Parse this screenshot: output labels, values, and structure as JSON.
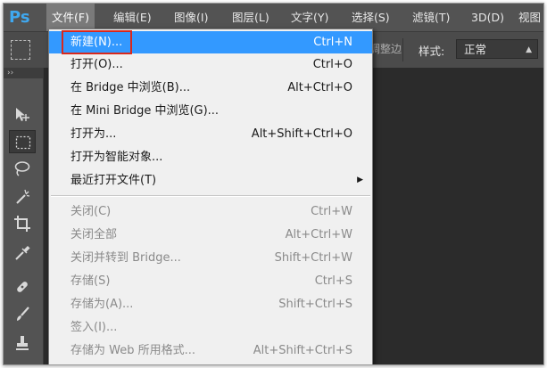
{
  "app": {
    "logo": "Ps"
  },
  "menubar": {
    "items": [
      {
        "label": "文件(F)",
        "active": true
      },
      {
        "label": "编辑(E)"
      },
      {
        "label": "图像(I)"
      },
      {
        "label": "图层(L)"
      },
      {
        "label": "文字(Y)"
      },
      {
        "label": "选择(S)"
      },
      {
        "label": "滤镜(T)"
      },
      {
        "label": "3D(D)"
      },
      {
        "label": "视图"
      }
    ]
  },
  "options": {
    "partial_text": "调整边",
    "style_label": "样式:",
    "style_value": "正常"
  },
  "file_menu": {
    "items": [
      {
        "label": "新建(N)...",
        "shortcut": "Ctrl+N",
        "state": "highlight"
      },
      {
        "label": "打开(O)...",
        "shortcut": "Ctrl+O"
      },
      {
        "label": "在 Bridge 中浏览(B)...",
        "shortcut": "Alt+Ctrl+O"
      },
      {
        "label": "在 Mini Bridge 中浏览(G)...",
        "shortcut": ""
      },
      {
        "label": "打开为...",
        "shortcut": "Alt+Shift+Ctrl+O"
      },
      {
        "label": "打开为智能对象...",
        "shortcut": ""
      },
      {
        "label": "最近打开文件(T)",
        "shortcut": "",
        "submenu": true
      },
      {
        "label": "关闭(C)",
        "shortcut": "Ctrl+W",
        "state": "disabled"
      },
      {
        "label": "关闭全部",
        "shortcut": "Alt+Ctrl+W",
        "state": "disabled"
      },
      {
        "label": "关闭并转到 Bridge...",
        "shortcut": "Shift+Ctrl+W",
        "state": "disabled"
      },
      {
        "label": "存储(S)",
        "shortcut": "Ctrl+S",
        "state": "disabled"
      },
      {
        "label": "存储为(A)...",
        "shortcut": "Shift+Ctrl+S",
        "state": "disabled"
      },
      {
        "label": "签入(I)...",
        "shortcut": "",
        "state": "disabled"
      },
      {
        "label": "存储为 Web 所用格式...",
        "shortcut": "Alt+Shift+Ctrl+S",
        "state": "disabled"
      }
    ]
  },
  "toolbar": {
    "grip": "››",
    "tools": [
      "move-tool-icon",
      "rectangular-marquee-tool-icon",
      "lasso-tool-icon",
      "magic-wand-tool-icon",
      "crop-tool-icon",
      "eyedropper-tool-icon",
      "healing-brush-tool-icon",
      "brush-tool-icon",
      "clone-stamp-tool-icon"
    ],
    "selected_tool": "rectangular-marquee-tool-icon"
  },
  "colors": {
    "highlight": "#3399ff",
    "annotation": "#d8281d",
    "menubar": "#535353",
    "canvas": "#2b2b2b"
  }
}
